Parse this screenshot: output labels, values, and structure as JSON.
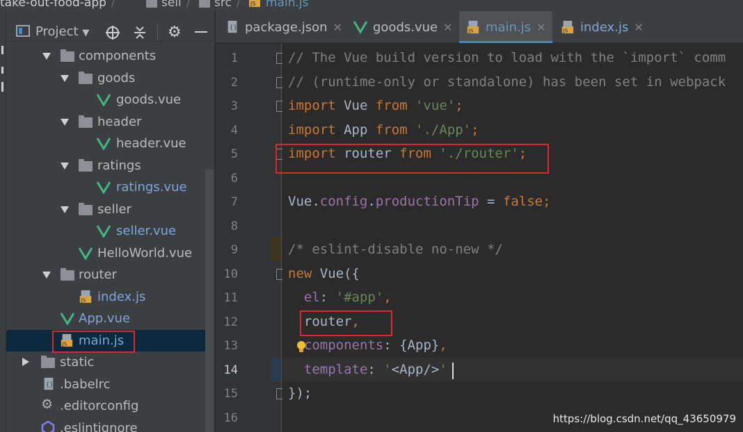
{
  "breadcrumb": [
    "take-out-food-app",
    "sell",
    "src",
    "main.js"
  ],
  "project_panel": {
    "title": "Project",
    "tree": [
      {
        "label": "components",
        "kind": "folder",
        "expanded": true
      },
      {
        "label": "goods",
        "kind": "folder",
        "expanded": true
      },
      {
        "label": "goods.vue",
        "kind": "vue"
      },
      {
        "label": "header",
        "kind": "folder",
        "expanded": true
      },
      {
        "label": "header.vue",
        "kind": "vue"
      },
      {
        "label": "ratings",
        "kind": "folder",
        "expanded": true
      },
      {
        "label": "ratings.vue",
        "kind": "vue"
      },
      {
        "label": "seller",
        "kind": "folder",
        "expanded": true
      },
      {
        "label": "seller.vue",
        "kind": "vue"
      },
      {
        "label": "HelloWorld.vue",
        "kind": "vue"
      },
      {
        "label": "router",
        "kind": "folder",
        "expanded": true
      },
      {
        "label": "index.js",
        "kind": "js"
      },
      {
        "label": "App.vue",
        "kind": "vue"
      },
      {
        "label": "main.js",
        "kind": "js",
        "selected": true
      },
      {
        "label": "static",
        "kind": "folder",
        "expanded": false
      },
      {
        "label": ".babelrc",
        "kind": "config"
      },
      {
        "label": ".editorconfig",
        "kind": "gear"
      },
      {
        "label": ".eslintignore",
        "kind": "eslint"
      }
    ]
  },
  "tabs": [
    {
      "label": "package.json",
      "icon": "json-file-icon",
      "active": false
    },
    {
      "label": "goods.vue",
      "icon": "vue-file-icon",
      "active": false
    },
    {
      "label": "main.js",
      "icon": "js-file-icon",
      "active": true
    },
    {
      "label": "index.js",
      "icon": "js-file-icon",
      "active": false
    }
  ],
  "editor": {
    "current_line": 14,
    "line_numbers": [
      "1",
      "2",
      "3",
      "4",
      "5",
      "6",
      "7",
      "8",
      "9",
      "10",
      "11",
      "12",
      "13",
      "14",
      "15",
      "16"
    ],
    "lines": {
      "l1": "// The Vue build version to load with the `import` comm",
      "l2": "// (runtime-only or standalone) has been set in webpack",
      "l3_kw": "import",
      "l3_a": " Vue ",
      "l3_kw2": "from",
      "l3_str": " 'vue'",
      "l3_end": ";",
      "l4_kw": "import",
      "l4_a": " App ",
      "l4_kw2": "from",
      "l4_str": " './App'",
      "l4_end": ";",
      "l5_kw": "import",
      "l5_a": " router ",
      "l5_kw2": "from",
      "l5_str": " './router'",
      "l5_end": ";",
      "l7_a": "Vue.",
      "l7_p1": "config",
      "l7_dot": ".",
      "l7_p2": "productionTip",
      "l7_eq": " = ",
      "l7_kw": "false",
      "l7_end": ";",
      "l9": "/* eslint-disable no-new */",
      "l10_kw": "new",
      "l10_a": " Vue({",
      "l11_p": "  el",
      "l11_c": ": ",
      "l11_str": "'#app'",
      "l11_end": ",",
      "l12_a": "  router",
      "l12_end": ",",
      "l13_p": "  components",
      "l13_a": ": {App}",
      "l13_end": ",",
      "l14_p": "  template",
      "l14_c": ": ",
      "l14_str1": "'",
      "l14_a": "<App/>",
      "l14_str2": "'",
      "l15": "});"
    }
  },
  "watermark": "https://blog.csdn.net/qq_43650979",
  "colors": {
    "keyword": "#cc7832",
    "string": "#6a8759",
    "comment": "#808080",
    "property": "#9876aa",
    "highlight_box": "#e0262b"
  }
}
